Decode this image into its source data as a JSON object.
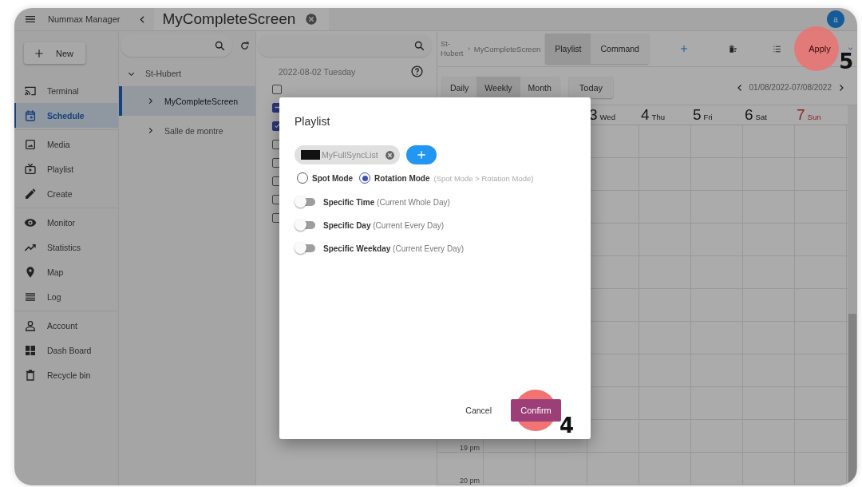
{
  "topbar": {
    "app_name": "Nummax Manager",
    "tab_title": "MyCompleteScreen",
    "avatar": "a"
  },
  "sidebar": {
    "new_button": "New",
    "groups": [
      [
        {
          "label": "Terminal",
          "kind": "cast",
          "selected": false
        },
        {
          "label": "Schedule",
          "kind": "calendar",
          "selected": true
        }
      ],
      [
        {
          "label": "Media",
          "kind": "image",
          "selected": false
        },
        {
          "label": "Playlist",
          "kind": "tv",
          "selected": false
        },
        {
          "label": "Create",
          "kind": "pencil",
          "selected": false
        }
      ],
      [
        {
          "label": "Monitor",
          "kind": "eye",
          "selected": false
        },
        {
          "label": "Statistics",
          "kind": "trend",
          "selected": false
        },
        {
          "label": "Map",
          "kind": "pin",
          "selected": false
        },
        {
          "label": "Log",
          "kind": "lines",
          "selected": false
        }
      ],
      [
        {
          "label": "Account",
          "kind": "person",
          "selected": false
        },
        {
          "label": "Dash Board",
          "kind": "dashboard",
          "selected": false
        },
        {
          "label": "Recycle bin",
          "kind": "trash",
          "selected": false
        }
      ]
    ]
  },
  "tree": {
    "items": [
      {
        "label": "St-Hubert",
        "expanded": true,
        "selected": false,
        "children": [
          {
            "label": "MyCompleteScreen",
            "expanded": false,
            "selected": true
          },
          {
            "label": "Salle de montre",
            "expanded": false,
            "selected": false
          }
        ]
      }
    ]
  },
  "day_list": {
    "date": "2022-08-02 Tuesday",
    "rows": [
      {
        "checked": false,
        "indeterminate": false
      },
      {
        "checked": true,
        "indeterminate": true
      },
      {
        "checked": true,
        "indeterminate": false
      },
      {
        "checked": false,
        "indeterminate": false
      },
      {
        "checked": false,
        "indeterminate": false
      },
      {
        "checked": false,
        "indeterminate": false
      },
      {
        "checked": false,
        "indeterminate": false
      },
      {
        "checked": false,
        "indeterminate": false
      }
    ]
  },
  "calendar": {
    "breadcrumb": [
      "St-Hubert",
      "MyCompleteScreen"
    ],
    "tabs": [
      {
        "label": "Playlist",
        "selected": true
      },
      {
        "label": "Command",
        "selected": false
      }
    ],
    "apply_button": {
      "label": "Apply",
      "step": "5"
    },
    "views": [
      {
        "label": "Daily",
        "selected": false
      },
      {
        "label": "Weekly",
        "selected": true
      },
      {
        "label": "Month",
        "selected": false
      }
    ],
    "today_button": "Today",
    "range": "01/08/2022-07/08/2022",
    "days": [
      {
        "number": "3",
        "name": "Wed",
        "weekend": false
      },
      {
        "number": "4",
        "name": "Thu",
        "weekend": false
      },
      {
        "number": "5",
        "name": "Fri",
        "weekend": false
      },
      {
        "number": "6",
        "name": "Sat",
        "weekend": false
      },
      {
        "number": "7",
        "name": "Sun",
        "weekend": true
      }
    ],
    "times": [
      "19 pm",
      "20 pm"
    ]
  },
  "dialog": {
    "title": "Playlist",
    "chip": "MyFullSyncList",
    "modes": [
      {
        "label": "Spot Mode",
        "selected": false
      },
      {
        "label": "Rotation Mode",
        "selected": true
      }
    ],
    "mode_hint": "(Spot Mode > Rotation Mode)",
    "switches": [
      {
        "label": "Specific Time",
        "note": "(Current Whole Day)",
        "on": false
      },
      {
        "label": "Specific Day",
        "note": "(Current Every Day)",
        "on": false
      },
      {
        "label": "Specific Weekday",
        "note": "(Current Every Day)",
        "on": false
      }
    ],
    "cancel": "Cancel",
    "confirm": {
      "label": "Confirm",
      "step": "4"
    }
  }
}
